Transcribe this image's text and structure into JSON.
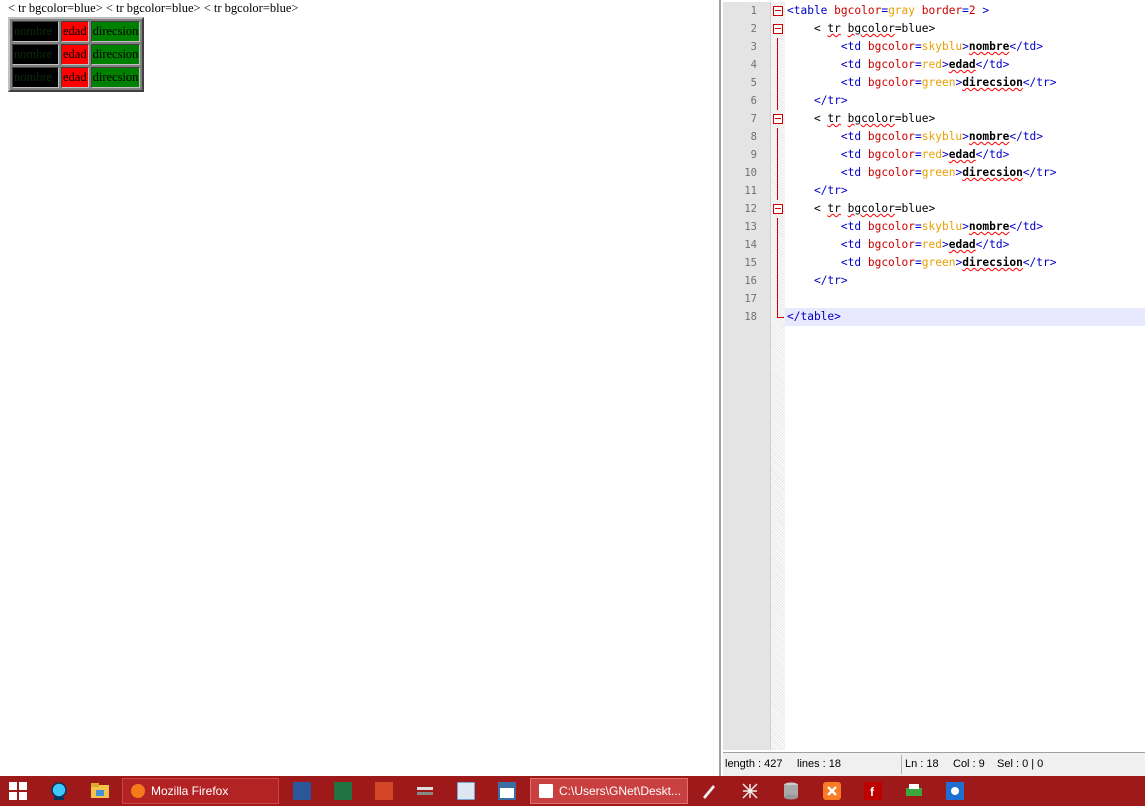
{
  "browser": {
    "stray_text": "< tr bgcolor=blue> < tr bgcolor=blue> < tr bgcolor=blue>",
    "table_rows": [
      {
        "c1": "nombre",
        "c2": "edad",
        "c3": "direcsion"
      },
      {
        "c1": "nombre",
        "c2": "edad",
        "c3": "direcsion"
      },
      {
        "c1": "nombre",
        "c2": "edad",
        "c3": "direcsion"
      }
    ]
  },
  "editor": {
    "lines": [
      {
        "n": "1",
        "tokens": [
          [
            "k",
            "<table "
          ],
          [
            "a",
            "bgcolor"
          ],
          [
            "k",
            "="
          ],
          [
            "v",
            "gray"
          ],
          [
            "a",
            " border"
          ],
          [
            "k",
            "="
          ],
          [
            "a",
            "2"
          ],
          [
            "k",
            " >"
          ]
        ]
      },
      {
        "n": "2",
        "tokens": [
          [
            "t",
            "    < "
          ],
          [
            "tu",
            "tr"
          ],
          [
            "t",
            " "
          ],
          [
            "tu",
            "bgcolor"
          ],
          [
            "t",
            "=blue>"
          ]
        ]
      },
      {
        "n": "3",
        "tokens": [
          [
            "t",
            "        "
          ],
          [
            "k",
            "<td "
          ],
          [
            "a",
            "bgcolor"
          ],
          [
            "k",
            "="
          ],
          [
            "v",
            "skyblu"
          ],
          [
            "k",
            ">"
          ],
          [
            "bu",
            "nombre"
          ],
          [
            "k",
            "</td>"
          ]
        ]
      },
      {
        "n": "4",
        "tokens": [
          [
            "t",
            "        "
          ],
          [
            "k",
            "<td "
          ],
          [
            "a",
            "bgcolor"
          ],
          [
            "k",
            "="
          ],
          [
            "v",
            "red"
          ],
          [
            "k",
            ">"
          ],
          [
            "bu",
            "edad"
          ],
          [
            "k",
            "</td>"
          ]
        ]
      },
      {
        "n": "5",
        "tokens": [
          [
            "t",
            "        "
          ],
          [
            "k",
            "<td "
          ],
          [
            "a",
            "bgcolor"
          ],
          [
            "k",
            "="
          ],
          [
            "v",
            "green"
          ],
          [
            "k",
            ">"
          ],
          [
            "bu",
            "direcsion"
          ],
          [
            "k",
            "</tr>"
          ]
        ]
      },
      {
        "n": "6",
        "tokens": [
          [
            "t",
            "    "
          ],
          [
            "k",
            "</tr>"
          ]
        ]
      },
      {
        "n": "7",
        "tokens": [
          [
            "t",
            "    < "
          ],
          [
            "tu",
            "tr"
          ],
          [
            "t",
            " "
          ],
          [
            "tu",
            "bgcolor"
          ],
          [
            "t",
            "=blue>"
          ]
        ]
      },
      {
        "n": "8",
        "tokens": [
          [
            "t",
            "        "
          ],
          [
            "k",
            "<td "
          ],
          [
            "a",
            "bgcolor"
          ],
          [
            "k",
            "="
          ],
          [
            "v",
            "skyblu"
          ],
          [
            "k",
            ">"
          ],
          [
            "bu",
            "nombre"
          ],
          [
            "k",
            "</td>"
          ]
        ]
      },
      {
        "n": "9",
        "tokens": [
          [
            "t",
            "        "
          ],
          [
            "k",
            "<td "
          ],
          [
            "a",
            "bgcolor"
          ],
          [
            "k",
            "="
          ],
          [
            "v",
            "red"
          ],
          [
            "k",
            ">"
          ],
          [
            "bu",
            "edad"
          ],
          [
            "k",
            "</td>"
          ]
        ]
      },
      {
        "n": "10",
        "tokens": [
          [
            "t",
            "        "
          ],
          [
            "k",
            "<td "
          ],
          [
            "a",
            "bgcolor"
          ],
          [
            "k",
            "="
          ],
          [
            "v",
            "green"
          ],
          [
            "k",
            ">"
          ],
          [
            "bu",
            "direcsion"
          ],
          [
            "k",
            "</tr>"
          ]
        ]
      },
      {
        "n": "11",
        "tokens": [
          [
            "t",
            "    "
          ],
          [
            "k",
            "</tr>"
          ]
        ]
      },
      {
        "n": "12",
        "tokens": [
          [
            "t",
            "    < "
          ],
          [
            "tu",
            "tr"
          ],
          [
            "t",
            " "
          ],
          [
            "tu",
            "bgcolor"
          ],
          [
            "t",
            "=blue>"
          ]
        ]
      },
      {
        "n": "13",
        "tokens": [
          [
            "t",
            "        "
          ],
          [
            "k",
            "<td "
          ],
          [
            "a",
            "bgcolor"
          ],
          [
            "k",
            "="
          ],
          [
            "v",
            "skyblu"
          ],
          [
            "k",
            ">"
          ],
          [
            "bu",
            "nombre"
          ],
          [
            "k",
            "</td>"
          ]
        ]
      },
      {
        "n": "14",
        "tokens": [
          [
            "t",
            "        "
          ],
          [
            "k",
            "<td "
          ],
          [
            "a",
            "bgcolor"
          ],
          [
            "k",
            "="
          ],
          [
            "v",
            "red"
          ],
          [
            "k",
            ">"
          ],
          [
            "bu",
            "edad"
          ],
          [
            "k",
            "</td>"
          ]
        ]
      },
      {
        "n": "15",
        "tokens": [
          [
            "t",
            "        "
          ],
          [
            "k",
            "<td "
          ],
          [
            "a",
            "bgcolor"
          ],
          [
            "k",
            "="
          ],
          [
            "v",
            "green"
          ],
          [
            "k",
            ">"
          ],
          [
            "bu",
            "direcsion"
          ],
          [
            "k",
            "</tr>"
          ]
        ]
      },
      {
        "n": "16",
        "tokens": [
          [
            "t",
            "    "
          ],
          [
            "k",
            "</tr>"
          ]
        ]
      },
      {
        "n": "17",
        "tokens": []
      },
      {
        "n": "18",
        "tokens": [
          [
            "k",
            "</table>"
          ]
        ]
      }
    ],
    "status": {
      "length": "length : 427",
      "lines": "lines : 18",
      "ln": "Ln : 18",
      "col": "Col : 9",
      "sel": "Sel : 0 | 0"
    }
  },
  "taskbar": {
    "firefox_label": "Mozilla Firefox",
    "notepad_label": "C:\\Users\\GNet\\Deskt...",
    "icons": {
      "start": "windows-start-icon",
      "word": "W",
      "excel": "X",
      "powerpoint": "P",
      "vb": "VB"
    },
    "colors": {
      "taskbar": "#9e1a1a",
      "accent": "#c84040"
    }
  }
}
